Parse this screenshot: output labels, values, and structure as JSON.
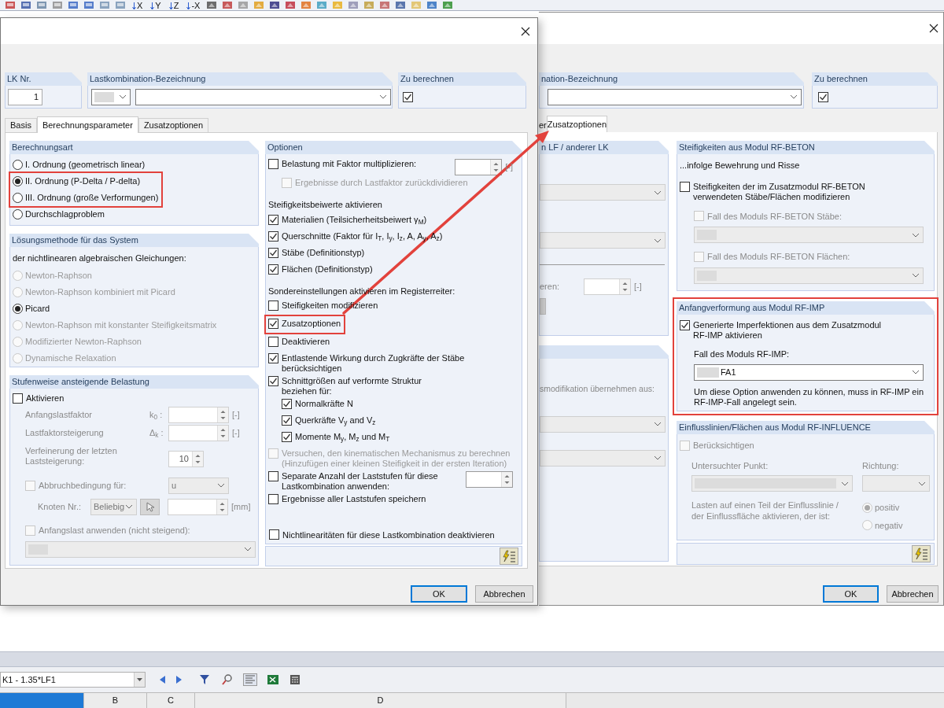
{
  "toolbar": {
    "axis_buttons": [
      "X",
      "Y",
      "Z",
      "-X"
    ]
  },
  "arrow_annotation": true,
  "back_dialog": {
    "bezeichnung_label": "nation-Bezeichnung",
    "zu_berechnen": {
      "label": "Zu berechnen",
      "checked": true
    },
    "tabs": [
      {
        "label": "er",
        "selected": false
      },
      {
        "label": "Zusatzoptionen",
        "selected": true
      }
    ],
    "left_panel": {
      "title": "n LF / anderer LK",
      "spin_label": "eren:",
      "unit": "[-]"
    },
    "left_panel_2": {
      "text": "smodifikation übernehmen aus:"
    },
    "beton": {
      "title": "Steifigkeiten aus Modul RF-BETON",
      "subtitle": "...infolge Bewehrung und Risse",
      "option": {
        "label": "Steifigkeiten der im Zusatzmodul RF-BETON\nverwendeten Stäbe/Flächen modifizieren",
        "checked": false
      },
      "cases": [
        {
          "label": "Fall des Moduls RF-BETON Stäbe:",
          "checked": false,
          "disabled": true
        },
        {
          "label": "Fall des Moduls RF-BETON Flächen:",
          "checked": false,
          "disabled": true
        }
      ]
    },
    "imp": {
      "title": "Anfangverformung aus Modul RF-IMP",
      "highlighted": true,
      "option": {
        "label": "Generierte Imperfektionen aus dem Zusatzmodul\nRF-IMP aktivieren",
        "checked": true
      },
      "case_label": "Fall des Moduls RF-IMP:",
      "case_value": "FA1",
      "note": "Um diese Option anwenden zu können, muss in RF-IMP ein\nRF-IMP-Fall angelegt sein."
    },
    "influence": {
      "title": "Einflusslinien/Flächen aus Modul RF-INFLUENCE",
      "disabled": true,
      "option": {
        "label": "Berücksichtigen",
        "checked": false
      },
      "point_label": "Untersuchter Punkt:",
      "direction_label": "Richtung:",
      "text": "Lasten auf einen Teil der Einflusslinie /\nder Einflussfläche aktivieren, der ist:",
      "signs": [
        {
          "label": "positiv",
          "selected": true
        },
        {
          "label": "negativ",
          "selected": false
        }
      ]
    },
    "buttons": [
      "OK",
      "Abbrechen"
    ]
  },
  "front_dialog": {
    "lk_nr": {
      "label": "LK Nr.",
      "value": "1"
    },
    "bezeichnung": {
      "label": "Lastkombination-Bezeichnung"
    },
    "zu_berechnen": {
      "label": "Zu berechnen",
      "checked": true
    },
    "tabs": [
      {
        "label": "Basis",
        "selected": false
      },
      {
        "label": "Berechnungsparameter",
        "selected": true
      },
      {
        "label": "Zusatzoptionen",
        "selected": false
      }
    ],
    "berechnungsart": {
      "title": "Berechnungsart",
      "options": [
        {
          "label": "I. Ordnung (geometrisch linear)",
          "selected": false,
          "highlighted": false
        },
        {
          "label": "II. Ordnung (P-Delta / P-delta)",
          "selected": true,
          "highlighted": true
        },
        {
          "label": "III. Ordnung (große Verformungen)",
          "selected": false,
          "highlighted": true
        },
        {
          "label": "Durchschlagproblem",
          "selected": false,
          "highlighted": false
        }
      ]
    },
    "loesungsmethode": {
      "title": "Lösungsmethode für das System",
      "subtitle": "der nichtlinearen algebraischen Gleichungen:",
      "options": [
        {
          "label": "Newton-Raphson",
          "selected": false,
          "disabled": true
        },
        {
          "label": "Newton-Raphson kombiniert mit Picard",
          "selected": false,
          "disabled": true
        },
        {
          "label": "Picard",
          "selected": true,
          "disabled": false
        },
        {
          "label": "Newton-Raphson mit konstanter Steifigkeitsmatrix",
          "selected": false,
          "disabled": true
        },
        {
          "label": "Modifizierter Newton-Raphson",
          "selected": false,
          "disabled": true
        },
        {
          "label": "Dynamische Relaxation",
          "selected": false,
          "disabled": true
        }
      ]
    },
    "stufenweise": {
      "title": "Stufenweise ansteigende Belastung",
      "aktivieren": {
        "label": "Aktivieren",
        "checked": false
      },
      "controls_disabled": true,
      "fields": [
        {
          "label": "Anfangslastfaktor",
          "symbol": "k$_{0}$ :",
          "unit": "[-]"
        },
        {
          "label": "Lastfaktorsteigerung",
          "symbol": "Δ$_{k}$ :",
          "unit": "[-]"
        }
      ],
      "verfeinerung": {
        "label": "Verfeinerung der letzten\nLaststeigerung:",
        "value": "10"
      },
      "abbruch": {
        "label": "Abbruchbedingung für:",
        "checked": false,
        "value": "u"
      },
      "knoten": {
        "label": "Knoten Nr.:",
        "value": "Beliebig",
        "unit": "[mm]"
      },
      "anfangslast": {
        "label": "Anfangslast anwenden (nicht steigend):",
        "checked": false
      }
    },
    "optionen": {
      "title": "Optionen",
      "items": [
        {
          "kind": "checkbox",
          "label": "Belastung mit Faktor multiplizieren:",
          "checked": false,
          "disabled": false,
          "highlighted": false,
          "spinner": true,
          "unit": "[-]",
          "children": [
            {
              "kind": "checkbox",
              "label": "Ergebnisse durch Lastfaktor zurückdividieren",
              "checked": false,
              "disabled": true,
              "highlighted": false
            }
          ]
        },
        {
          "kind": "heading",
          "label": "Steifigkeitsbeiwerte aktivieren",
          "highlighted": false
        },
        {
          "kind": "checkbox",
          "label": "Materialien (Teilsicherheitsbeiwert γ$_{M}$)",
          "checked": true,
          "disabled": false,
          "highlighted": false
        },
        {
          "kind": "checkbox",
          "label": "Querschnitte (Faktor für I$_{T}$, I$_{y}$, I$_{z}$, A, A$_{y}$, A$_{z}$)",
          "checked": true,
          "disabled": false,
          "highlighted": false
        },
        {
          "kind": "checkbox",
          "label": "Stäbe (Definitionstyp)",
          "checked": true,
          "disabled": false,
          "highlighted": false
        },
        {
          "kind": "checkbox",
          "label": "Flächen (Definitionstyp)",
          "checked": true,
          "disabled": false,
          "highlighted": false
        },
        {
          "kind": "heading",
          "label": "Sondereinstellungen aktivieren im Registerreiter:",
          "highlighted": false
        },
        {
          "kind": "checkbox",
          "label": "Steifigkeiten modifizieren",
          "checked": false,
          "disabled": false,
          "highlighted": false
        },
        {
          "kind": "checkbox",
          "label": "Zusatzoptionen",
          "checked": true,
          "disabled": false,
          "highlighted": true
        },
        {
          "kind": "checkbox",
          "label": "Deaktivieren",
          "checked": false,
          "disabled": false,
          "highlighted": false
        },
        {
          "kind": "checkbox",
          "label": "Entlastende Wirkung durch Zugkräfte der Stäbe\nberücksichtigen",
          "checked": true,
          "disabled": false,
          "highlighted": false
        },
        {
          "kind": "checkbox",
          "label": "Schnittgrößen auf verformte Struktur\nbeziehen für:",
          "checked": true,
          "disabled": false,
          "highlighted": false,
          "children": [
            {
              "kind": "checkbox",
              "label": "Normalkräfte N",
              "checked": true,
              "disabled": false,
              "highlighted": false
            },
            {
              "kind": "checkbox",
              "label": "Querkräfte V$_{y}$ and V$_{z}$",
              "checked": true,
              "disabled": false,
              "highlighted": false
            },
            {
              "kind": "checkbox",
              "label": "Momente M$_{y}$, M$_{z}$ und M$_{T}$",
              "checked": true,
              "disabled": false,
              "highlighted": false
            }
          ]
        },
        {
          "kind": "checkbox",
          "label": "Versuchen, den kinematischen Mechanismus zu berechnen\n(Hinzufügen einer kleinen Steifigkeit in der ersten Iteration)",
          "checked": false,
          "disabled": true,
          "highlighted": false
        },
        {
          "kind": "checkbox",
          "label": "Separate Anzahl der Laststufen für diese\nLastkombination anwenden:",
          "checked": false,
          "disabled": false,
          "highlighted": false,
          "spinner": true
        },
        {
          "kind": "checkbox",
          "label": "Ergebnisse aller Laststufen speichern",
          "checked": false,
          "disabled": false,
          "highlighted": false
        }
      ],
      "footer_option": {
        "label": "Nichtlinearitäten für diese Lastkombination deaktivieren",
        "checked": false
      }
    },
    "buttons": [
      "OK",
      "Abbrechen"
    ]
  },
  "bottom": {
    "combo": "K1 - 1.35*LF1",
    "columns": [
      {
        "selected": true
      },
      {
        "label": "B",
        "selected": false
      },
      {
        "label": "C",
        "selected": false
      },
      {
        "label": "D",
        "selected": false
      }
    ]
  }
}
